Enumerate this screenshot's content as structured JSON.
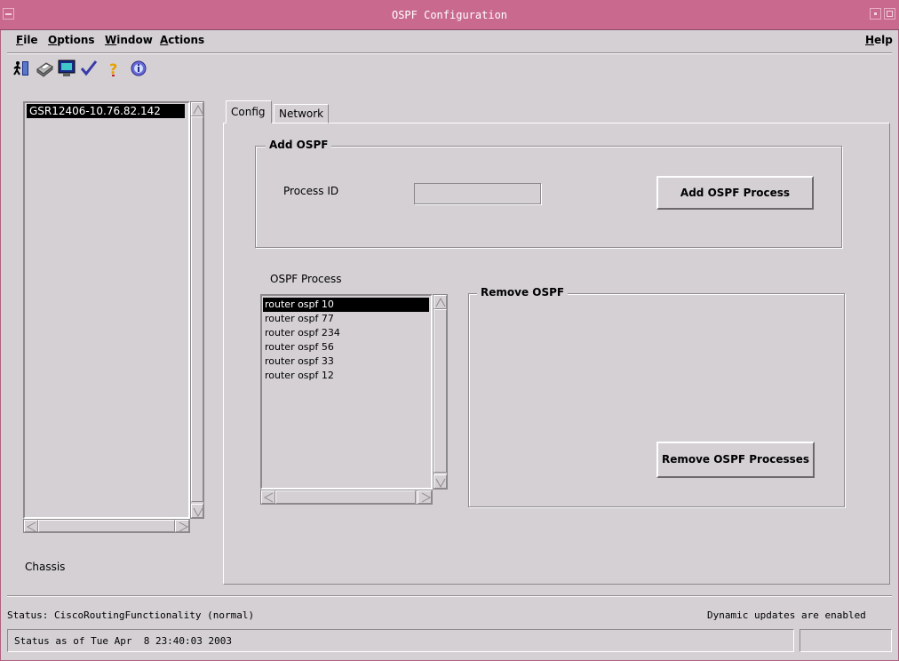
{
  "window": {
    "title": "OSPF Configuration"
  },
  "menubar": {
    "file": "File",
    "options": "Options",
    "window": "Window",
    "actions": "Actions",
    "help": "Help"
  },
  "toolbar": {
    "icons": [
      "exit-icon",
      "print-icon",
      "screen-icon",
      "check-icon",
      "help-icon",
      "info-icon"
    ]
  },
  "tree": {
    "items": [
      "GSR12406-10.76.82.142"
    ],
    "footer_label": "Chassis"
  },
  "tabs": [
    {
      "label": "Config",
      "active": true
    },
    {
      "label": "Network",
      "active": false
    }
  ],
  "add_ospf": {
    "title": "Add OSPF",
    "process_id_label": "Process ID",
    "process_id_value": "",
    "button": "Add OSPF Process"
  },
  "ospf_process": {
    "label": "OSPF Process",
    "items": [
      "router ospf 10",
      "router ospf 77",
      "router ospf 234",
      "router ospf 56",
      "router ospf 33",
      "router ospf 12"
    ],
    "selected_index": 0
  },
  "remove_ospf": {
    "title": "Remove OSPF",
    "button": "Remove OSPF Processes"
  },
  "status": {
    "text": "Status: CiscoRoutingFunctionality (normal)",
    "dynamic": "Dynamic updates are enabled",
    "as_of": "Status as of Tue Apr  8 23:40:03 2003"
  },
  "colors": {
    "title_bar": "#c9698e",
    "background": "#d4d0d4",
    "selection": "#000000"
  }
}
